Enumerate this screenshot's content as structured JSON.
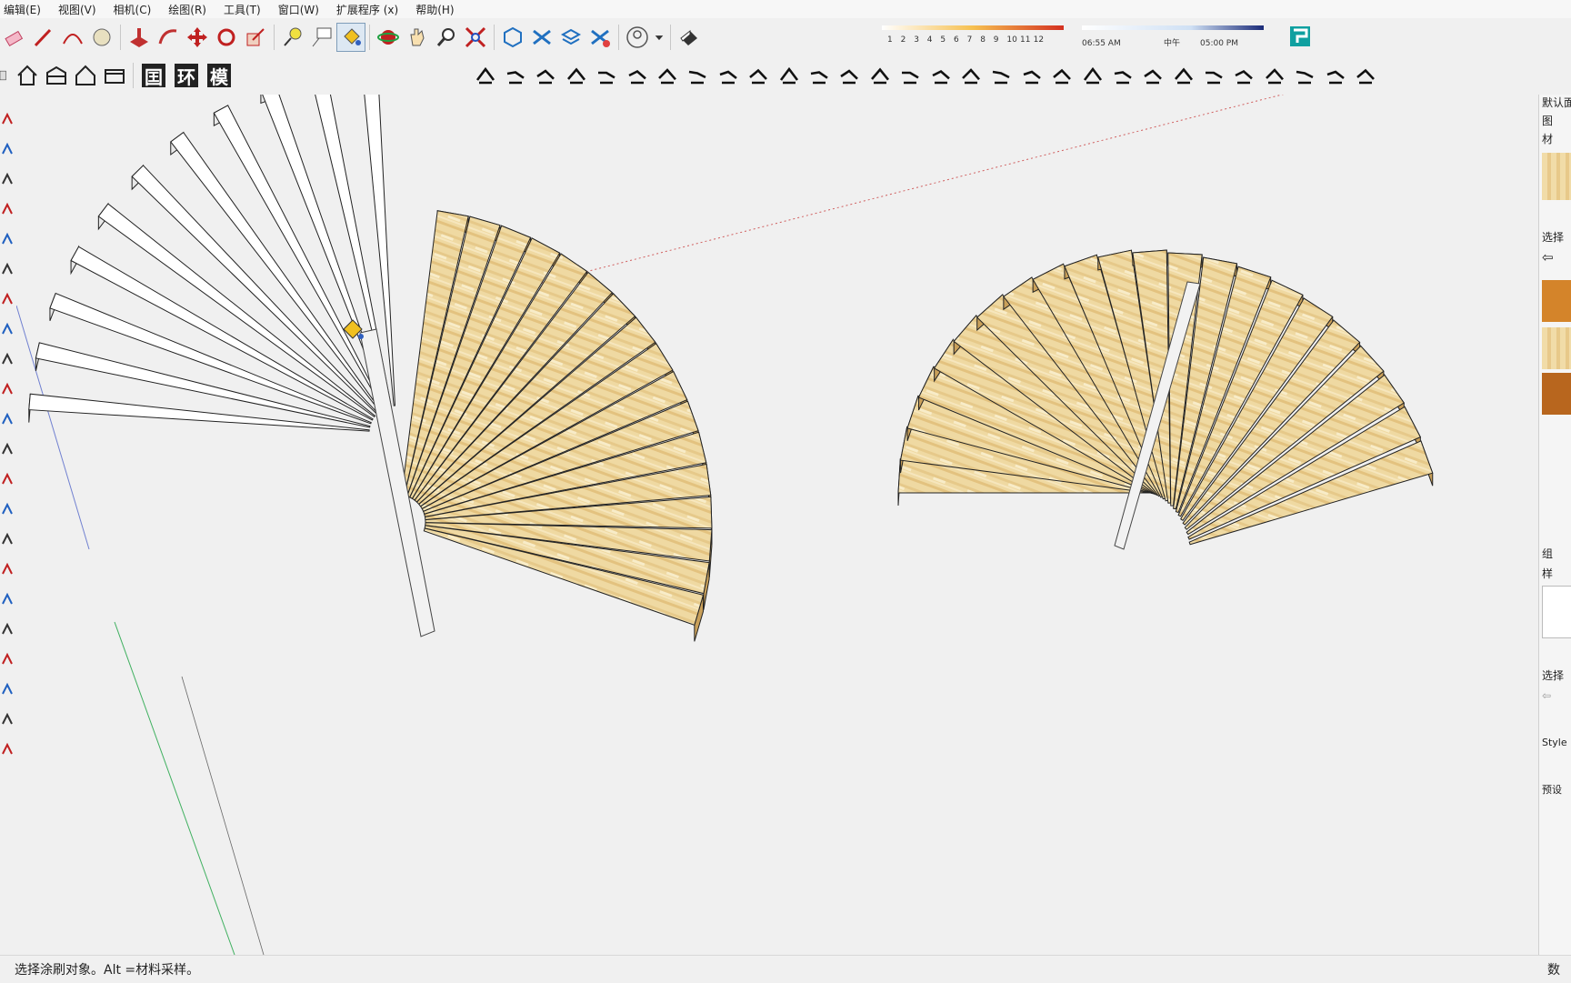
{
  "menubar": {
    "items": [
      "编辑(E)",
      "视图(V)",
      "相机(C)",
      "绘图(R)",
      "工具(T)",
      "窗口(W)",
      "扩展程序 (x)",
      "帮助(H)"
    ]
  },
  "toolbar": {
    "text_buttons": [
      "囯",
      "环",
      "模"
    ]
  },
  "shadow": {
    "months": [
      "1",
      "2",
      "3",
      "4",
      "5",
      "6",
      "7",
      "8",
      "9",
      "10",
      "11",
      "12"
    ],
    "time_start": "06:55 AM",
    "time_noon": "中午",
    "time_end": "05:00 PM"
  },
  "right_panel": {
    "label_default": "默认面",
    "label_layers": "图",
    "label_materials": "材",
    "label_select1": "选择",
    "label_components": "组",
    "label_styles": "样",
    "label_select2": "选择",
    "label_style": "Style",
    "label_preset": "预设"
  },
  "status": {
    "message": "选择涂刷对象。Alt =材料采样。",
    "right": "数"
  },
  "colors": {
    "wood_light": "#efd9a2",
    "wood_mid": "#e3c27f",
    "wood_dark": "#c9a05a",
    "accent_red": "#d4202a"
  }
}
